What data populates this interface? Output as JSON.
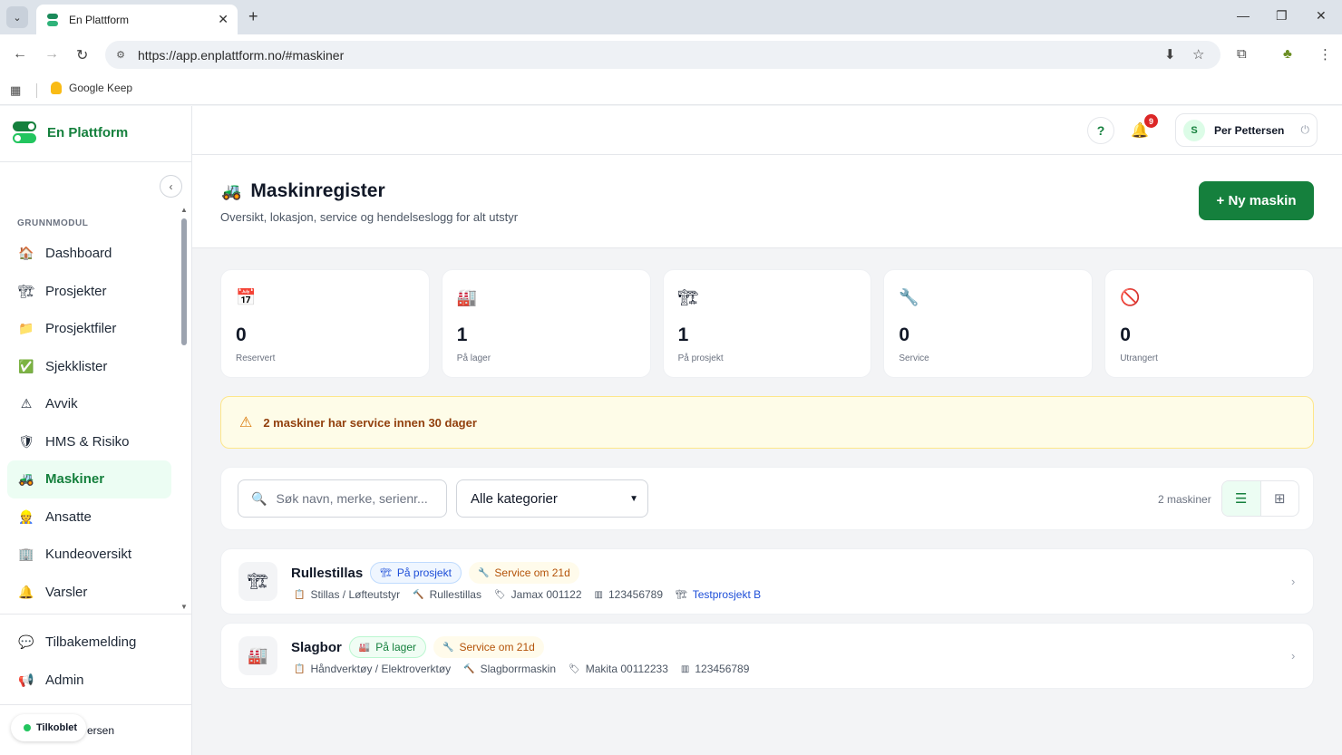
{
  "browser": {
    "tab_title": "En Plattform",
    "url": "https://app.enplattform.no/#maskiner",
    "bookmark": "Google Keep"
  },
  "app": {
    "brand": "En Plattform",
    "section_label": "GRUNNMODUL",
    "nav": [
      {
        "label": "Dashboard",
        "icon": "house-icon",
        "glyph": "🏠"
      },
      {
        "label": "Prosjekter",
        "icon": "crane-icon",
        "glyph": "🏗"
      },
      {
        "label": "Prosjektfiler",
        "icon": "folder-icon",
        "glyph": "📁"
      },
      {
        "label": "Sjekklister",
        "icon": "checkbox-icon",
        "glyph": "✅"
      },
      {
        "label": "Avvik",
        "icon": "warning-icon",
        "glyph": "⚠"
      },
      {
        "label": "HMS & Risiko",
        "icon": "shield-icon",
        "glyph": "🛡"
      },
      {
        "label": "Maskiner",
        "icon": "tractor-icon",
        "glyph": "🚜"
      },
      {
        "label": "Ansatte",
        "icon": "worker-icon",
        "glyph": "👷"
      },
      {
        "label": "Kundeoversikt",
        "icon": "building-icon",
        "glyph": "🏢"
      },
      {
        "label": "Varsler",
        "icon": "bell-icon",
        "glyph": "🔔"
      }
    ],
    "nav_secondary": [
      {
        "label": "Tilbakemelding",
        "icon": "speech-bubble-icon",
        "glyph": "💬"
      },
      {
        "label": "Admin",
        "icon": "admin-icon",
        "glyph": "📢"
      }
    ],
    "footer_user_partial": "ersen",
    "online_status": "Tilkoblet",
    "topbar": {
      "help": "?",
      "notification_count": "9",
      "user_initial": "S",
      "user_name": "Per Pettersen"
    }
  },
  "page": {
    "title": "Maskinregister",
    "subtitle": "Oversikt, lokasjon, service og hendelseslogg for alt utstyr",
    "new_button": "+ Ny maskin"
  },
  "stats": [
    {
      "value": "0",
      "label": "Reservert",
      "icon": "calendar-icon",
      "glyph": "📅"
    },
    {
      "value": "1",
      "label": "På lager",
      "icon": "factory-icon",
      "glyph": "🏭"
    },
    {
      "value": "1",
      "label": "På prosjekt",
      "icon": "crane-icon",
      "glyph": "🏗"
    },
    {
      "value": "0",
      "label": "Service",
      "icon": "wrench-icon",
      "glyph": "🔧"
    },
    {
      "value": "0",
      "label": "Utrangert",
      "icon": "prohibited-icon",
      "glyph": "🚫"
    }
  ],
  "alert": {
    "text": "2 maskiner har service innen 30 dager"
  },
  "filters": {
    "search_placeholder": "Søk navn, merke, serienr...",
    "category_selected": "Alle kategorier",
    "count": "2 maskiner"
  },
  "machines": [
    {
      "name": "Rullestillas",
      "icon": "crane-icon",
      "glyph": "🏗",
      "status": "På prosjekt",
      "service": "Service om 21d",
      "category": "Stillas / Løfteutstyr",
      "type": "Rullestillas",
      "brand": "Jamax 001122",
      "serial": "123456789",
      "project": "Testprosjekt B"
    },
    {
      "name": "Slagbor",
      "icon": "factory-icon",
      "glyph": "🏭",
      "status": "På lager",
      "service": "Service om 21d",
      "category": "Håndverktøy / Elektroverktøy",
      "type": "Slagborrmaskin",
      "brand": "Makita 00112233",
      "serial": "123456789"
    }
  ],
  "colors": {
    "brand_green": "#15803d",
    "alert_bg": "#fefce8",
    "alert_text": "#92400e",
    "project_blue": "#1d4ed8",
    "badge_red": "#dc2626"
  }
}
